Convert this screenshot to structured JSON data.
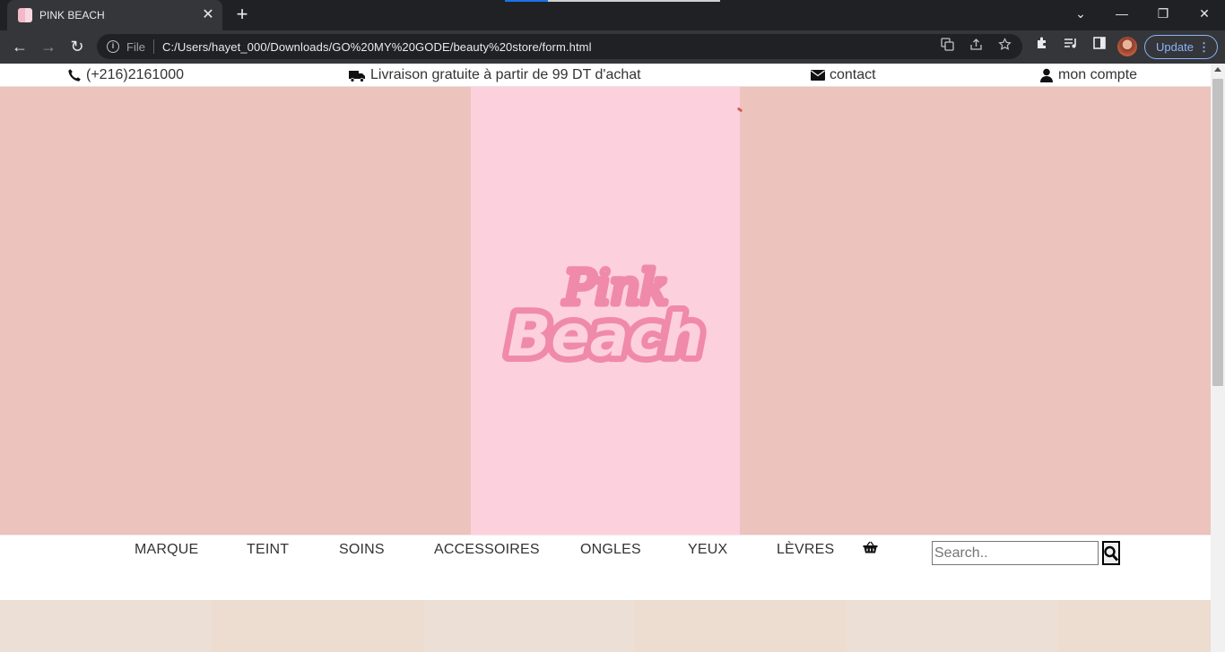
{
  "browser": {
    "tab_title": "PINK BEACH",
    "tab_close": "✕",
    "new_tab": "+",
    "window_controls": {
      "dropdown": "⌄",
      "minimize": "—",
      "restore": "❐",
      "close": "✕"
    },
    "nav": {
      "back": "←",
      "forward": "→",
      "reload": "↻"
    },
    "omnibox": {
      "info_icon": "i",
      "scheme_label": "File",
      "url": "C:/Users/hayet_000/Downloads/GO%20MY%20GODE/beauty%20store/form.html"
    },
    "update_label": "Update",
    "update_menu": "⋮"
  },
  "page": {
    "topbar": {
      "phone": "(+216)2161000",
      "shipping": "Livraison gratuite à partir de 99 DT d'achat",
      "contact": "contact",
      "account": "mon compte"
    },
    "hero": {
      "logo_line1": "Pink",
      "logo_line2": "Beach",
      "colors": {
        "side": "#edc3bd",
        "center": "#fdd0de",
        "logo": "#f08aaa"
      }
    },
    "nav": {
      "items": [
        "MARQUE",
        "TEINT",
        "SOINS",
        "ACCESSOIRES",
        "ONGLES",
        "YEUX",
        "LÈVRES"
      ]
    },
    "search": {
      "placeholder": "Search.."
    }
  }
}
